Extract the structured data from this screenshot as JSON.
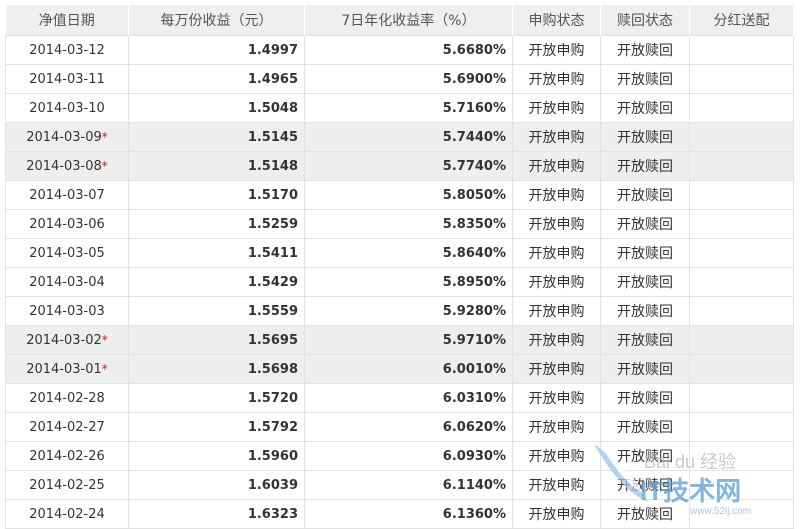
{
  "columns": [
    "净值日期",
    "每万份收益（元）",
    "7日年化收益率（%）",
    "申购状态",
    "赎回状态",
    "分红送配"
  ],
  "rows": [
    {
      "date": "2014-03-12",
      "star": "",
      "income": "1.4997",
      "yield": "5.6680%",
      "buy": "开放申购",
      "redeem": "开放赎回",
      "dividend": "",
      "shaded": false
    },
    {
      "date": "2014-03-11",
      "star": "",
      "income": "1.4965",
      "yield": "5.6900%",
      "buy": "开放申购",
      "redeem": "开放赎回",
      "dividend": "",
      "shaded": false
    },
    {
      "date": "2014-03-10",
      "star": "",
      "income": "1.5048",
      "yield": "5.7160%",
      "buy": "开放申购",
      "redeem": "开放赎回",
      "dividend": "",
      "shaded": false
    },
    {
      "date": "2014-03-09",
      "star": "*",
      "income": "1.5145",
      "yield": "5.7440%",
      "buy": "开放申购",
      "redeem": "开放赎回",
      "dividend": "",
      "shaded": true
    },
    {
      "date": "2014-03-08",
      "star": "*",
      "income": "1.5148",
      "yield": "5.7740%",
      "buy": "开放申购",
      "redeem": "开放赎回",
      "dividend": "",
      "shaded": true
    },
    {
      "date": "2014-03-07",
      "star": "",
      "income": "1.5170",
      "yield": "5.8050%",
      "buy": "开放申购",
      "redeem": "开放赎回",
      "dividend": "",
      "shaded": false
    },
    {
      "date": "2014-03-06",
      "star": "",
      "income": "1.5259",
      "yield": "5.8350%",
      "buy": "开放申购",
      "redeem": "开放赎回",
      "dividend": "",
      "shaded": false
    },
    {
      "date": "2014-03-05",
      "star": "",
      "income": "1.5411",
      "yield": "5.8640%",
      "buy": "开放申购",
      "redeem": "开放赎回",
      "dividend": "",
      "shaded": false
    },
    {
      "date": "2014-03-04",
      "star": "",
      "income": "1.5429",
      "yield": "5.8950%",
      "buy": "开放申购",
      "redeem": "开放赎回",
      "dividend": "",
      "shaded": false
    },
    {
      "date": "2014-03-03",
      "star": "",
      "income": "1.5559",
      "yield": "5.9280%",
      "buy": "开放申购",
      "redeem": "开放赎回",
      "dividend": "",
      "shaded": false
    },
    {
      "date": "2014-03-02",
      "star": "*",
      "income": "1.5695",
      "yield": "5.9710%",
      "buy": "开放申购",
      "redeem": "开放赎回",
      "dividend": "",
      "shaded": true
    },
    {
      "date": "2014-03-01",
      "star": "*",
      "income": "1.5698",
      "yield": "6.0010%",
      "buy": "开放申购",
      "redeem": "开放赎回",
      "dividend": "",
      "shaded": true
    },
    {
      "date": "2014-02-28",
      "star": "",
      "income": "1.5720",
      "yield": "6.0310%",
      "buy": "开放申购",
      "redeem": "开放赎回",
      "dividend": "",
      "shaded": false
    },
    {
      "date": "2014-02-27",
      "star": "",
      "income": "1.5792",
      "yield": "6.0620%",
      "buy": "开放申购",
      "redeem": "开放赎回",
      "dividend": "",
      "shaded": false
    },
    {
      "date": "2014-02-26",
      "star": "",
      "income": "1.5960",
      "yield": "6.0930%",
      "buy": "开放申购",
      "redeem": "开放赎回",
      "dividend": "",
      "shaded": false
    },
    {
      "date": "2014-02-25",
      "star": "",
      "income": "1.6039",
      "yield": "6.1140%",
      "buy": "开放申购",
      "redeem": "开放赎回",
      "dividend": "",
      "shaded": false
    },
    {
      "date": "2014-02-24",
      "star": "",
      "income": "1.6323",
      "yield": "6.1360%",
      "buy": "开放申购",
      "redeem": "开放赎回",
      "dividend": "",
      "shaded": false
    }
  ],
  "watermark": {
    "line1": "Bai du 经验",
    "line2": "IT技术网",
    "url": "www.52ij.com",
    "color": "#6fa8dc"
  }
}
